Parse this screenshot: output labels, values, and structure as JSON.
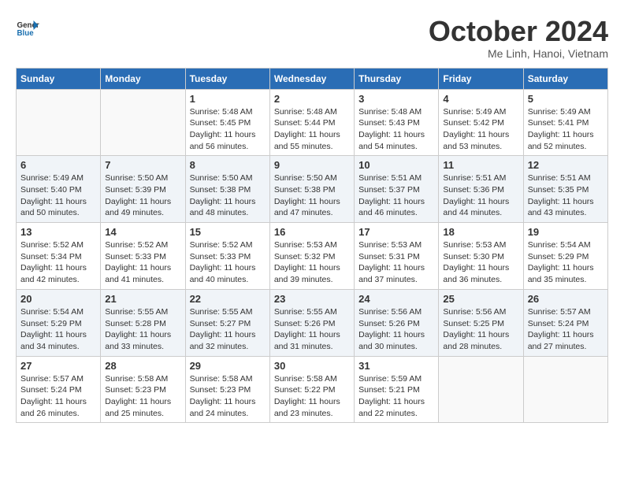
{
  "header": {
    "logo_line1": "General",
    "logo_line2": "Blue",
    "month": "October 2024",
    "location": "Me Linh, Hanoi, Vietnam"
  },
  "days_of_week": [
    "Sunday",
    "Monday",
    "Tuesday",
    "Wednesday",
    "Thursday",
    "Friday",
    "Saturday"
  ],
  "weeks": [
    [
      {
        "day": "",
        "info": ""
      },
      {
        "day": "",
        "info": ""
      },
      {
        "day": "1",
        "info": "Sunrise: 5:48 AM\nSunset: 5:45 PM\nDaylight: 11 hours and 56 minutes."
      },
      {
        "day": "2",
        "info": "Sunrise: 5:48 AM\nSunset: 5:44 PM\nDaylight: 11 hours and 55 minutes."
      },
      {
        "day": "3",
        "info": "Sunrise: 5:48 AM\nSunset: 5:43 PM\nDaylight: 11 hours and 54 minutes."
      },
      {
        "day": "4",
        "info": "Sunrise: 5:49 AM\nSunset: 5:42 PM\nDaylight: 11 hours and 53 minutes."
      },
      {
        "day": "5",
        "info": "Sunrise: 5:49 AM\nSunset: 5:41 PM\nDaylight: 11 hours and 52 minutes."
      }
    ],
    [
      {
        "day": "6",
        "info": "Sunrise: 5:49 AM\nSunset: 5:40 PM\nDaylight: 11 hours and 50 minutes."
      },
      {
        "day": "7",
        "info": "Sunrise: 5:50 AM\nSunset: 5:39 PM\nDaylight: 11 hours and 49 minutes."
      },
      {
        "day": "8",
        "info": "Sunrise: 5:50 AM\nSunset: 5:38 PM\nDaylight: 11 hours and 48 minutes."
      },
      {
        "day": "9",
        "info": "Sunrise: 5:50 AM\nSunset: 5:38 PM\nDaylight: 11 hours and 47 minutes."
      },
      {
        "day": "10",
        "info": "Sunrise: 5:51 AM\nSunset: 5:37 PM\nDaylight: 11 hours and 46 minutes."
      },
      {
        "day": "11",
        "info": "Sunrise: 5:51 AM\nSunset: 5:36 PM\nDaylight: 11 hours and 44 minutes."
      },
      {
        "day": "12",
        "info": "Sunrise: 5:51 AM\nSunset: 5:35 PM\nDaylight: 11 hours and 43 minutes."
      }
    ],
    [
      {
        "day": "13",
        "info": "Sunrise: 5:52 AM\nSunset: 5:34 PM\nDaylight: 11 hours and 42 minutes."
      },
      {
        "day": "14",
        "info": "Sunrise: 5:52 AM\nSunset: 5:33 PM\nDaylight: 11 hours and 41 minutes."
      },
      {
        "day": "15",
        "info": "Sunrise: 5:52 AM\nSunset: 5:33 PM\nDaylight: 11 hours and 40 minutes."
      },
      {
        "day": "16",
        "info": "Sunrise: 5:53 AM\nSunset: 5:32 PM\nDaylight: 11 hours and 39 minutes."
      },
      {
        "day": "17",
        "info": "Sunrise: 5:53 AM\nSunset: 5:31 PM\nDaylight: 11 hours and 37 minutes."
      },
      {
        "day": "18",
        "info": "Sunrise: 5:53 AM\nSunset: 5:30 PM\nDaylight: 11 hours and 36 minutes."
      },
      {
        "day": "19",
        "info": "Sunrise: 5:54 AM\nSunset: 5:29 PM\nDaylight: 11 hours and 35 minutes."
      }
    ],
    [
      {
        "day": "20",
        "info": "Sunrise: 5:54 AM\nSunset: 5:29 PM\nDaylight: 11 hours and 34 minutes."
      },
      {
        "day": "21",
        "info": "Sunrise: 5:55 AM\nSunset: 5:28 PM\nDaylight: 11 hours and 33 minutes."
      },
      {
        "day": "22",
        "info": "Sunrise: 5:55 AM\nSunset: 5:27 PM\nDaylight: 11 hours and 32 minutes."
      },
      {
        "day": "23",
        "info": "Sunrise: 5:55 AM\nSunset: 5:26 PM\nDaylight: 11 hours and 31 minutes."
      },
      {
        "day": "24",
        "info": "Sunrise: 5:56 AM\nSunset: 5:26 PM\nDaylight: 11 hours and 30 minutes."
      },
      {
        "day": "25",
        "info": "Sunrise: 5:56 AM\nSunset: 5:25 PM\nDaylight: 11 hours and 28 minutes."
      },
      {
        "day": "26",
        "info": "Sunrise: 5:57 AM\nSunset: 5:24 PM\nDaylight: 11 hours and 27 minutes."
      }
    ],
    [
      {
        "day": "27",
        "info": "Sunrise: 5:57 AM\nSunset: 5:24 PM\nDaylight: 11 hours and 26 minutes."
      },
      {
        "day": "28",
        "info": "Sunrise: 5:58 AM\nSunset: 5:23 PM\nDaylight: 11 hours and 25 minutes."
      },
      {
        "day": "29",
        "info": "Sunrise: 5:58 AM\nSunset: 5:23 PM\nDaylight: 11 hours and 24 minutes."
      },
      {
        "day": "30",
        "info": "Sunrise: 5:58 AM\nSunset: 5:22 PM\nDaylight: 11 hours and 23 minutes."
      },
      {
        "day": "31",
        "info": "Sunrise: 5:59 AM\nSunset: 5:21 PM\nDaylight: 11 hours and 22 minutes."
      },
      {
        "day": "",
        "info": ""
      },
      {
        "day": "",
        "info": ""
      }
    ]
  ]
}
